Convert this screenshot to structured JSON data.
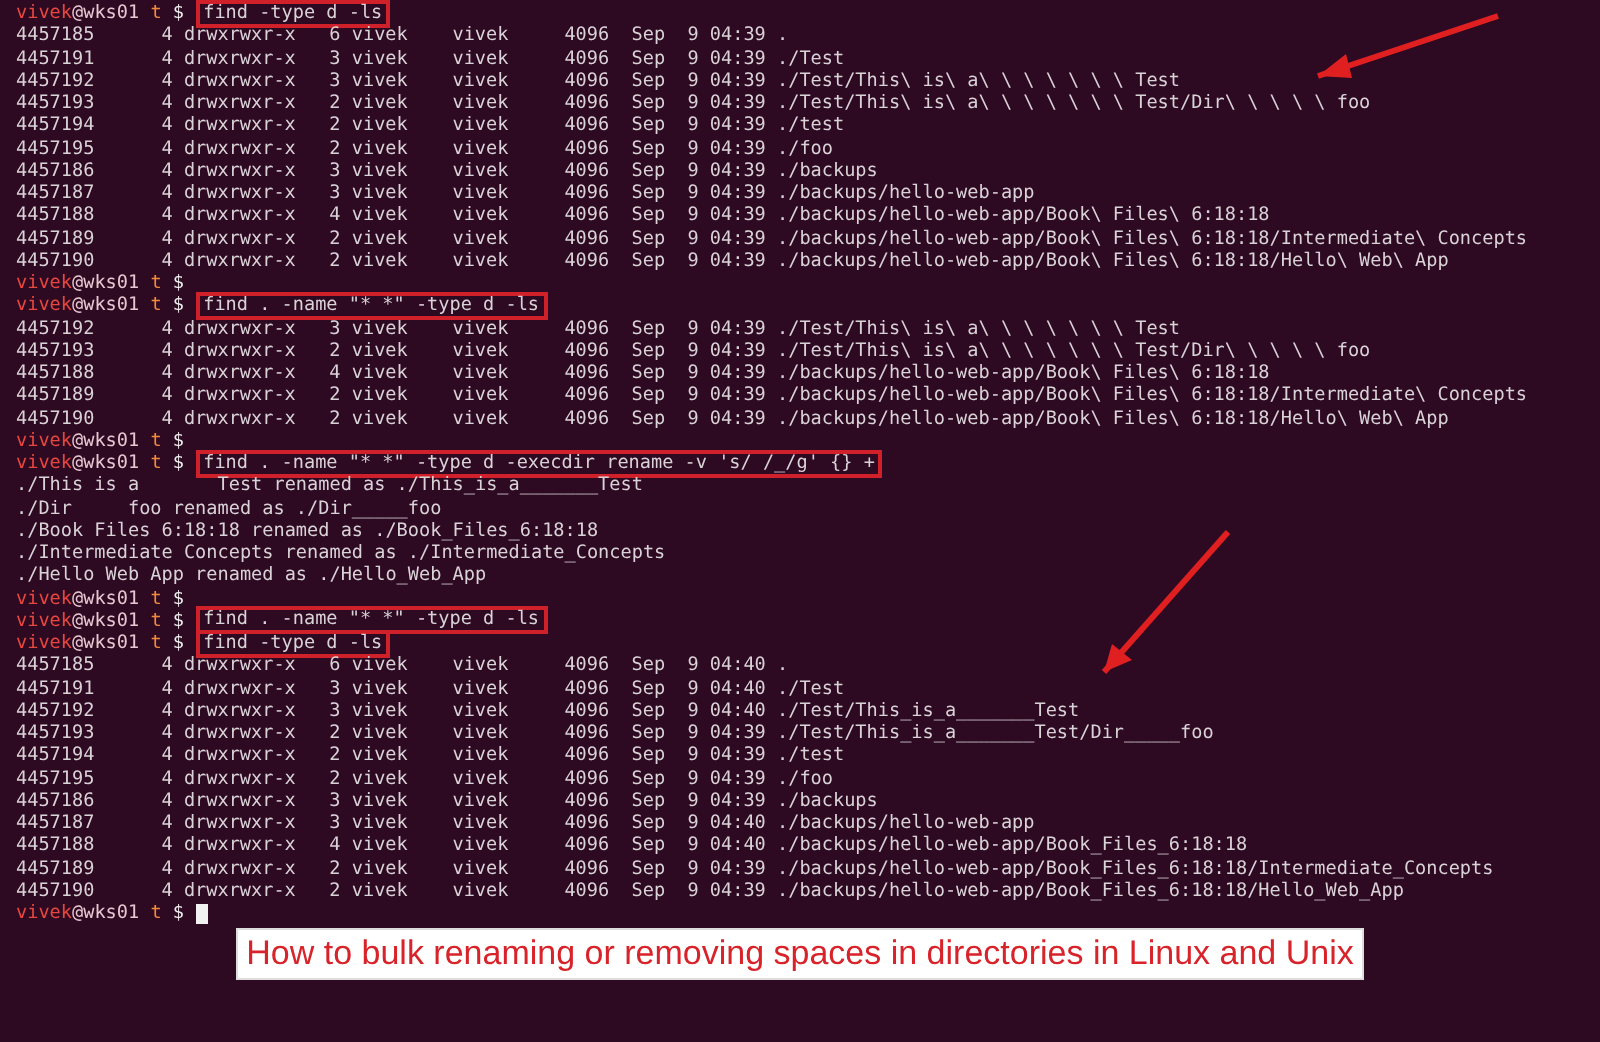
{
  "lines": [
    {
      "kind": "prompt",
      "user": "vivek",
      "host": "@wks01",
      "dir": "t",
      "symbol": "$",
      "command": "find -type d -ls",
      "boxed": true
    },
    {
      "kind": "entry",
      "inode": "4457185",
      "blocks": "4",
      "perms": "drwxrwxr-x",
      "links": "6",
      "owner": "vivek",
      "group": "vivek",
      "size": "4096",
      "month": "Sep",
      "day": "9",
      "time": "04:39",
      "path": "."
    },
    {
      "kind": "entry",
      "inode": "4457191",
      "blocks": "4",
      "perms": "drwxrwxr-x",
      "links": "3",
      "owner": "vivek",
      "group": "vivek",
      "size": "4096",
      "month": "Sep",
      "day": "9",
      "time": "04:39",
      "path": "./Test"
    },
    {
      "kind": "entry",
      "inode": "4457192",
      "blocks": "4",
      "perms": "drwxrwxr-x",
      "links": "3",
      "owner": "vivek",
      "group": "vivek",
      "size": "4096",
      "month": "Sep",
      "day": "9",
      "time": "04:39",
      "path": "./Test/This\\ is\\ a\\ \\ \\ \\ \\ \\ \\ Test"
    },
    {
      "kind": "entry",
      "inode": "4457193",
      "blocks": "4",
      "perms": "drwxrwxr-x",
      "links": "2",
      "owner": "vivek",
      "group": "vivek",
      "size": "4096",
      "month": "Sep",
      "day": "9",
      "time": "04:39",
      "path": "./Test/This\\ is\\ a\\ \\ \\ \\ \\ \\ \\ Test/Dir\\ \\ \\ \\ \\ foo"
    },
    {
      "kind": "entry",
      "inode": "4457194",
      "blocks": "4",
      "perms": "drwxrwxr-x",
      "links": "2",
      "owner": "vivek",
      "group": "vivek",
      "size": "4096",
      "month": "Sep",
      "day": "9",
      "time": "04:39",
      "path": "./test"
    },
    {
      "kind": "entry",
      "inode": "4457195",
      "blocks": "4",
      "perms": "drwxrwxr-x",
      "links": "2",
      "owner": "vivek",
      "group": "vivek",
      "size": "4096",
      "month": "Sep",
      "day": "9",
      "time": "04:39",
      "path": "./foo"
    },
    {
      "kind": "entry",
      "inode": "4457186",
      "blocks": "4",
      "perms": "drwxrwxr-x",
      "links": "3",
      "owner": "vivek",
      "group": "vivek",
      "size": "4096",
      "month": "Sep",
      "day": "9",
      "time": "04:39",
      "path": "./backups"
    },
    {
      "kind": "entry",
      "inode": "4457187",
      "blocks": "4",
      "perms": "drwxrwxr-x",
      "links": "3",
      "owner": "vivek",
      "group": "vivek",
      "size": "4096",
      "month": "Sep",
      "day": "9",
      "time": "04:39",
      "path": "./backups/hello-web-app"
    },
    {
      "kind": "entry",
      "inode": "4457188",
      "blocks": "4",
      "perms": "drwxrwxr-x",
      "links": "4",
      "owner": "vivek",
      "group": "vivek",
      "size": "4096",
      "month": "Sep",
      "day": "9",
      "time": "04:39",
      "path": "./backups/hello-web-app/Book\\ Files\\ 6:18:18"
    },
    {
      "kind": "entry",
      "inode": "4457189",
      "blocks": "4",
      "perms": "drwxrwxr-x",
      "links": "2",
      "owner": "vivek",
      "group": "vivek",
      "size": "4096",
      "month": "Sep",
      "day": "9",
      "time": "04:39",
      "path": "./backups/hello-web-app/Book\\ Files\\ 6:18:18/Intermediate\\ Concepts"
    },
    {
      "kind": "entry",
      "inode": "4457190",
      "blocks": "4",
      "perms": "drwxrwxr-x",
      "links": "2",
      "owner": "vivek",
      "group": "vivek",
      "size": "4096",
      "month": "Sep",
      "day": "9",
      "time": "04:39",
      "path": "./backups/hello-web-app/Book\\ Files\\ 6:18:18/Hello\\ Web\\ App"
    },
    {
      "kind": "prompt",
      "user": "vivek",
      "host": "@wks01",
      "dir": "t",
      "symbol": "$"
    },
    {
      "kind": "prompt",
      "user": "vivek",
      "host": "@wks01",
      "dir": "t",
      "symbol": "$",
      "command": "find . -name \"* *\" -type d -ls",
      "boxed": true
    },
    {
      "kind": "entry",
      "inode": "4457192",
      "blocks": "4",
      "perms": "drwxrwxr-x",
      "links": "3",
      "owner": "vivek",
      "group": "vivek",
      "size": "4096",
      "month": "Sep",
      "day": "9",
      "time": "04:39",
      "path": "./Test/This\\ is\\ a\\ \\ \\ \\ \\ \\ \\ Test"
    },
    {
      "kind": "entry",
      "inode": "4457193",
      "blocks": "4",
      "perms": "drwxrwxr-x",
      "links": "2",
      "owner": "vivek",
      "group": "vivek",
      "size": "4096",
      "month": "Sep",
      "day": "9",
      "time": "04:39",
      "path": "./Test/This\\ is\\ a\\ \\ \\ \\ \\ \\ \\ Test/Dir\\ \\ \\ \\ \\ foo"
    },
    {
      "kind": "entry",
      "inode": "4457188",
      "blocks": "4",
      "perms": "drwxrwxr-x",
      "links": "4",
      "owner": "vivek",
      "group": "vivek",
      "size": "4096",
      "month": "Sep",
      "day": "9",
      "time": "04:39",
      "path": "./backups/hello-web-app/Book\\ Files\\ 6:18:18"
    },
    {
      "kind": "entry",
      "inode": "4457189",
      "blocks": "4",
      "perms": "drwxrwxr-x",
      "links": "2",
      "owner": "vivek",
      "group": "vivek",
      "size": "4096",
      "month": "Sep",
      "day": "9",
      "time": "04:39",
      "path": "./backups/hello-web-app/Book\\ Files\\ 6:18:18/Intermediate\\ Concepts"
    },
    {
      "kind": "entry",
      "inode": "4457190",
      "blocks": "4",
      "perms": "drwxrwxr-x",
      "links": "2",
      "owner": "vivek",
      "group": "vivek",
      "size": "4096",
      "month": "Sep",
      "day": "9",
      "time": "04:39",
      "path": "./backups/hello-web-app/Book\\ Files\\ 6:18:18/Hello\\ Web\\ App"
    },
    {
      "kind": "prompt",
      "user": "vivek",
      "host": "@wks01",
      "dir": "t",
      "symbol": "$"
    },
    {
      "kind": "prompt",
      "user": "vivek",
      "host": "@wks01",
      "dir": "t",
      "symbol": "$",
      "command": "find . -name \"* *\" -type d -execdir rename -v 's/ /_/g' {} +",
      "boxed": true
    },
    {
      "kind": "output",
      "text": "./This is a       Test renamed as ./This_is_a_______Test"
    },
    {
      "kind": "output",
      "text": "./Dir     foo renamed as ./Dir_____foo"
    },
    {
      "kind": "output",
      "text": "./Book Files 6:18:18 renamed as ./Book_Files_6:18:18"
    },
    {
      "kind": "output",
      "text": "./Intermediate Concepts renamed as ./Intermediate_Concepts"
    },
    {
      "kind": "output",
      "text": "./Hello Web App renamed as ./Hello_Web_App"
    },
    {
      "kind": "prompt",
      "user": "vivek",
      "host": "@wks01",
      "dir": "t",
      "symbol": "$"
    },
    {
      "kind": "prompt",
      "user": "vivek",
      "host": "@wks01",
      "dir": "t",
      "symbol": "$",
      "command": "find . -name \"* *\" -type d -ls",
      "boxed": true
    },
    {
      "kind": "prompt",
      "user": "vivek",
      "host": "@wks01",
      "dir": "t",
      "symbol": "$",
      "command": "find -type d -ls",
      "boxed": true
    },
    {
      "kind": "entry",
      "inode": "4457185",
      "blocks": "4",
      "perms": "drwxrwxr-x",
      "links": "6",
      "owner": "vivek",
      "group": "vivek",
      "size": "4096",
      "month": "Sep",
      "day": "9",
      "time": "04:40",
      "path": "."
    },
    {
      "kind": "entry",
      "inode": "4457191",
      "blocks": "4",
      "perms": "drwxrwxr-x",
      "links": "3",
      "owner": "vivek",
      "group": "vivek",
      "size": "4096",
      "month": "Sep",
      "day": "9",
      "time": "04:40",
      "path": "./Test"
    },
    {
      "kind": "entry",
      "inode": "4457192",
      "blocks": "4",
      "perms": "drwxrwxr-x",
      "links": "3",
      "owner": "vivek",
      "group": "vivek",
      "size": "4096",
      "month": "Sep",
      "day": "9",
      "time": "04:40",
      "path": "./Test/This_is_a_______Test"
    },
    {
      "kind": "entry",
      "inode": "4457193",
      "blocks": "4",
      "perms": "drwxrwxr-x",
      "links": "2",
      "owner": "vivek",
      "group": "vivek",
      "size": "4096",
      "month": "Sep",
      "day": "9",
      "time": "04:39",
      "path": "./Test/This_is_a_______Test/Dir_____foo"
    },
    {
      "kind": "entry",
      "inode": "4457194",
      "blocks": "4",
      "perms": "drwxrwxr-x",
      "links": "2",
      "owner": "vivek",
      "group": "vivek",
      "size": "4096",
      "month": "Sep",
      "day": "9",
      "time": "04:39",
      "path": "./test"
    },
    {
      "kind": "entry",
      "inode": "4457195",
      "blocks": "4",
      "perms": "drwxrwxr-x",
      "links": "2",
      "owner": "vivek",
      "group": "vivek",
      "size": "4096",
      "month": "Sep",
      "day": "9",
      "time": "04:39",
      "path": "./foo"
    },
    {
      "kind": "entry",
      "inode": "4457186",
      "blocks": "4",
      "perms": "drwxrwxr-x",
      "links": "3",
      "owner": "vivek",
      "group": "vivek",
      "size": "4096",
      "month": "Sep",
      "day": "9",
      "time": "04:39",
      "path": "./backups"
    },
    {
      "kind": "entry",
      "inode": "4457187",
      "blocks": "4",
      "perms": "drwxrwxr-x",
      "links": "3",
      "owner": "vivek",
      "group": "vivek",
      "size": "4096",
      "month": "Sep",
      "day": "9",
      "time": "04:40",
      "path": "./backups/hello-web-app"
    },
    {
      "kind": "entry",
      "inode": "4457188",
      "blocks": "4",
      "perms": "drwxrwxr-x",
      "links": "4",
      "owner": "vivek",
      "group": "vivek",
      "size": "4096",
      "month": "Sep",
      "day": "9",
      "time": "04:40",
      "path": "./backups/hello-web-app/Book_Files_6:18:18"
    },
    {
      "kind": "entry",
      "inode": "4457189",
      "blocks": "4",
      "perms": "drwxrwxr-x",
      "links": "2",
      "owner": "vivek",
      "group": "vivek",
      "size": "4096",
      "month": "Sep",
      "day": "9",
      "time": "04:39",
      "path": "./backups/hello-web-app/Book_Files_6:18:18/Intermediate_Concepts"
    },
    {
      "kind": "entry",
      "inode": "4457190",
      "blocks": "4",
      "perms": "drwxrwxr-x",
      "links": "2",
      "owner": "vivek",
      "group": "vivek",
      "size": "4096",
      "month": "Sep",
      "day": "9",
      "time": "04:39",
      "path": "./backups/hello-web-app/Book_Files_6:18:18/Hello_Web_App"
    },
    {
      "kind": "prompt",
      "user": "vivek",
      "host": "@wks01",
      "dir": "t",
      "symbol": "$",
      "cursor": true
    }
  ],
  "caption": "How to bulk renaming or removing spaces in directories in Linux and Unix"
}
